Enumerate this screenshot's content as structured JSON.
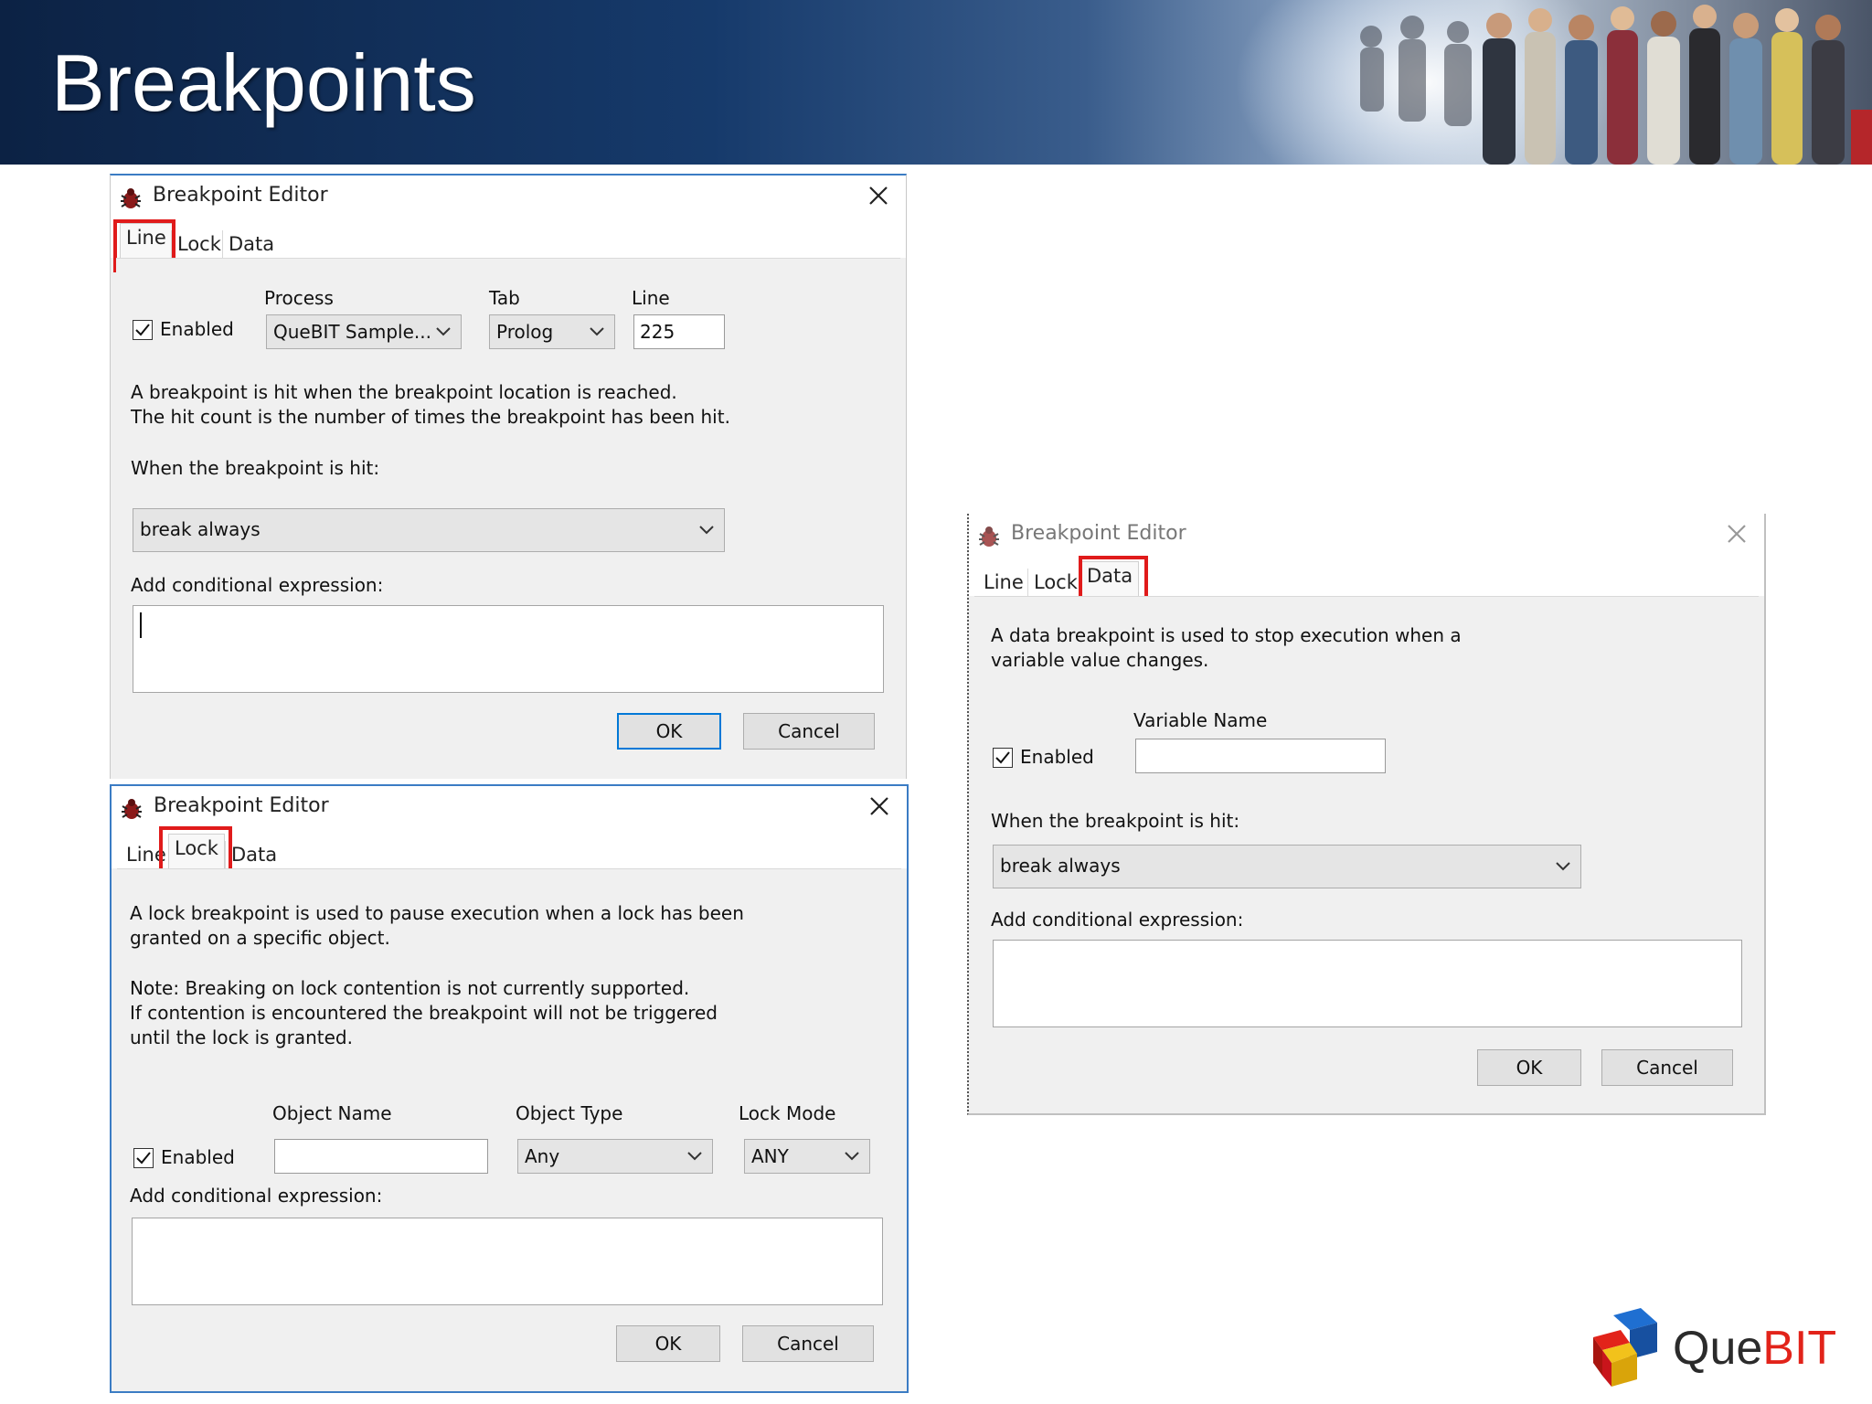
{
  "slide": {
    "title": "Breakpoints"
  },
  "logo": {
    "text_que": "Que",
    "text_bit": "BIT"
  },
  "dialog_line": {
    "title": "Breakpoint Editor",
    "tabs": [
      "Line",
      "Lock",
      "Data"
    ],
    "active_tab": "Line",
    "process_label": "Process",
    "tab_label": "Tab",
    "line_label": "Line",
    "enabled_label": "Enabled",
    "enabled_checked": true,
    "process_value": "QueBIT Sample...",
    "tab_value": "Prolog",
    "line_value": "225",
    "desc_line1": "A breakpoint is hit when the breakpoint location is reached.",
    "desc_line2": "The hit count is the number of times the breakpoint has been hit.",
    "when_hit_label": "When the breakpoint is hit:",
    "when_hit_value": "break always",
    "conditional_label": "Add conditional expression:",
    "conditional_value": "",
    "ok_label": "OK",
    "cancel_label": "Cancel"
  },
  "dialog_lock": {
    "title": "Breakpoint Editor",
    "tabs": [
      "Line",
      "Lock",
      "Data"
    ],
    "active_tab": "Lock",
    "desc_line1": "A lock breakpoint is used to pause execution when a lock has been",
    "desc_line2": "granted on a specific object.",
    "note_line1": "Note: Breaking on lock contention is not currently supported.",
    "note_line2": "If contention is encountered the breakpoint will not be triggered",
    "note_line3": "until the lock is granted.",
    "object_name_label": "Object Name",
    "object_type_label": "Object Type",
    "lock_mode_label": "Lock Mode",
    "enabled_label": "Enabled",
    "enabled_checked": true,
    "object_name_value": "",
    "object_type_value": "Any",
    "lock_mode_value": "ANY",
    "conditional_label": "Add conditional expression:",
    "ok_label": "OK",
    "cancel_label": "Cancel"
  },
  "dialog_data": {
    "title": "Breakpoint Editor",
    "tabs": [
      "Line",
      "Lock",
      "Data"
    ],
    "active_tab": "Data",
    "desc_line1": "A data breakpoint is used to stop execution when a",
    "desc_line2": "variable value changes.",
    "variable_name_label": "Variable Name",
    "enabled_label": "Enabled",
    "enabled_checked": true,
    "variable_name_value": "",
    "when_hit_label": "When the breakpoint is hit:",
    "when_hit_value": "break always",
    "conditional_label": "Add conditional expression:",
    "ok_label": "OK",
    "cancel_label": "Cancel"
  },
  "colors": {
    "highlight": "#e01b1b",
    "accent": "#0078d7",
    "dialog_bg": "#f0f0f0",
    "banner": "#163a6b"
  },
  "icons": {
    "app": "bug-icon",
    "close": "close-icon",
    "dropdown": "chevron-down-icon",
    "check": "checkmark-icon"
  }
}
